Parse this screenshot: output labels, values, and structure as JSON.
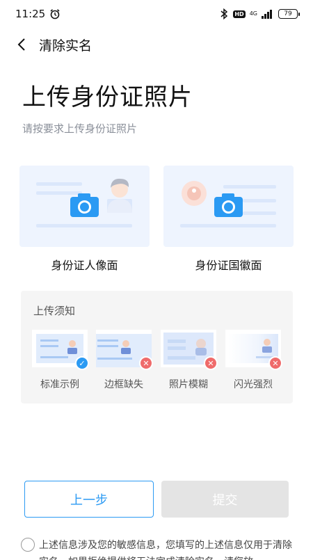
{
  "status_bar": {
    "time": "11:25",
    "hd": "HD",
    "network": "4G",
    "battery": "79"
  },
  "nav": {
    "title": "清除实名"
  },
  "header": {
    "title": "上传身份证照片",
    "subtitle": "请按要求上传身份证照片"
  },
  "upload": {
    "front_label": "身份证人像面",
    "back_label": "身份证国徽面"
  },
  "notice": {
    "title": "上传须知",
    "examples": [
      {
        "label": "标准示例",
        "status": "ok"
      },
      {
        "label": "边框缺失",
        "status": "bad"
      },
      {
        "label": "照片模糊",
        "status": "bad"
      },
      {
        "label": "闪光强烈",
        "status": "bad"
      }
    ]
  },
  "actions": {
    "prev_label": "上一步",
    "submit_label": "提交"
  },
  "agreement": {
    "text": "上述信息涉及您的敏感信息，您填写的上述信息仅用于清除实名，如果拒绝提供将无法完成清除实名，请您放"
  },
  "colors": {
    "accent": "#2b9af3",
    "error": "#ef6b6b",
    "card_bg": "#eef4fe",
    "panel_bg": "#f5f5f5",
    "disabled_btn": "#e4e4e4"
  }
}
